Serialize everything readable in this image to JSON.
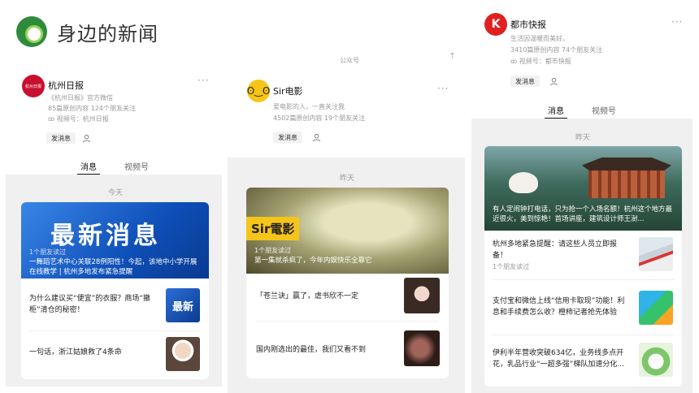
{
  "page": {
    "title": "身边的新闻"
  },
  "cards": [
    {
      "account": {
        "name": "杭州日报",
        "desc": "《杭州日报》官方微信",
        "stats": "85篇原创内容  124个朋友关注",
        "video": "视频号：杭州日报",
        "avatar_text": "杭州日报"
      },
      "actions": {
        "message": "发消息"
      },
      "tabs": [
        "消息",
        "视频号"
      ],
      "day": "今天",
      "hero": {
        "banner": "最新消息",
        "friends": "1个朋友读过",
        "caption": "一舞蹈艺术中心关联28例阳性！今起，该地中小学开展在线教学 | 杭州多地发布紧急提醒"
      },
      "items": [
        {
          "text": "为什么建议买“便宜”的衣服？商场“撤柜”清仓的秘密！",
          "thumb": "最新"
        },
        {
          "text": "一句话，浙江姑娘救了4条命"
        }
      ]
    },
    {
      "header_label": "公众号",
      "account": {
        "name": "Sir电影",
        "desc": "爱电影的人，一直关注我",
        "stats": "4502篇原创内容  19个朋友关注"
      },
      "actions": {
        "message": "发消息"
      },
      "day": "昨天",
      "hero": {
        "logo": "Sir電影",
        "friends": "1个朋友读过",
        "caption": "第一集就杀疯了，今年内娱快乐全靠它"
      },
      "items": [
        {
          "text": "「苍兰诀」赢了，虐书欣不一定"
        },
        {
          "text": "国内刚选出的最佳，我们又看不到"
        }
      ]
    },
    {
      "account": {
        "name": "都市快报",
        "desc": "生活因温暖而美好。",
        "stats": "3410篇原创内容  74个朋友关注",
        "video": "视频号：都市快报"
      },
      "actions": {
        "message": "发消息"
      },
      "tabs": [
        "消息",
        "视频号"
      ],
      "day": "昨天",
      "hero": {
        "caption": "有人定闹钟打电话，只为抢一个入场名额！杭州这个地方最近很火，美到惊艳！首场讲座，建筑设计师王澍..."
      },
      "items": [
        {
          "text": "杭州多地紧急提醒：请这些人员立即报备！",
          "sub": "1个朋友读过"
        },
        {
          "text": "支付宝和微信上线“信用卡取现”功能！利息和手续费怎么收？橙柿记者抢先体验"
        },
        {
          "text": "伊利半年营收突破634亿，业务线多点开花，乳品行业“一超多强”梯队加速分化..."
        }
      ]
    }
  ],
  "colors": {
    "green": "#2e8b3c",
    "lightgreen": "#9ad45a",
    "blue_banner": "#1a5fd0"
  }
}
